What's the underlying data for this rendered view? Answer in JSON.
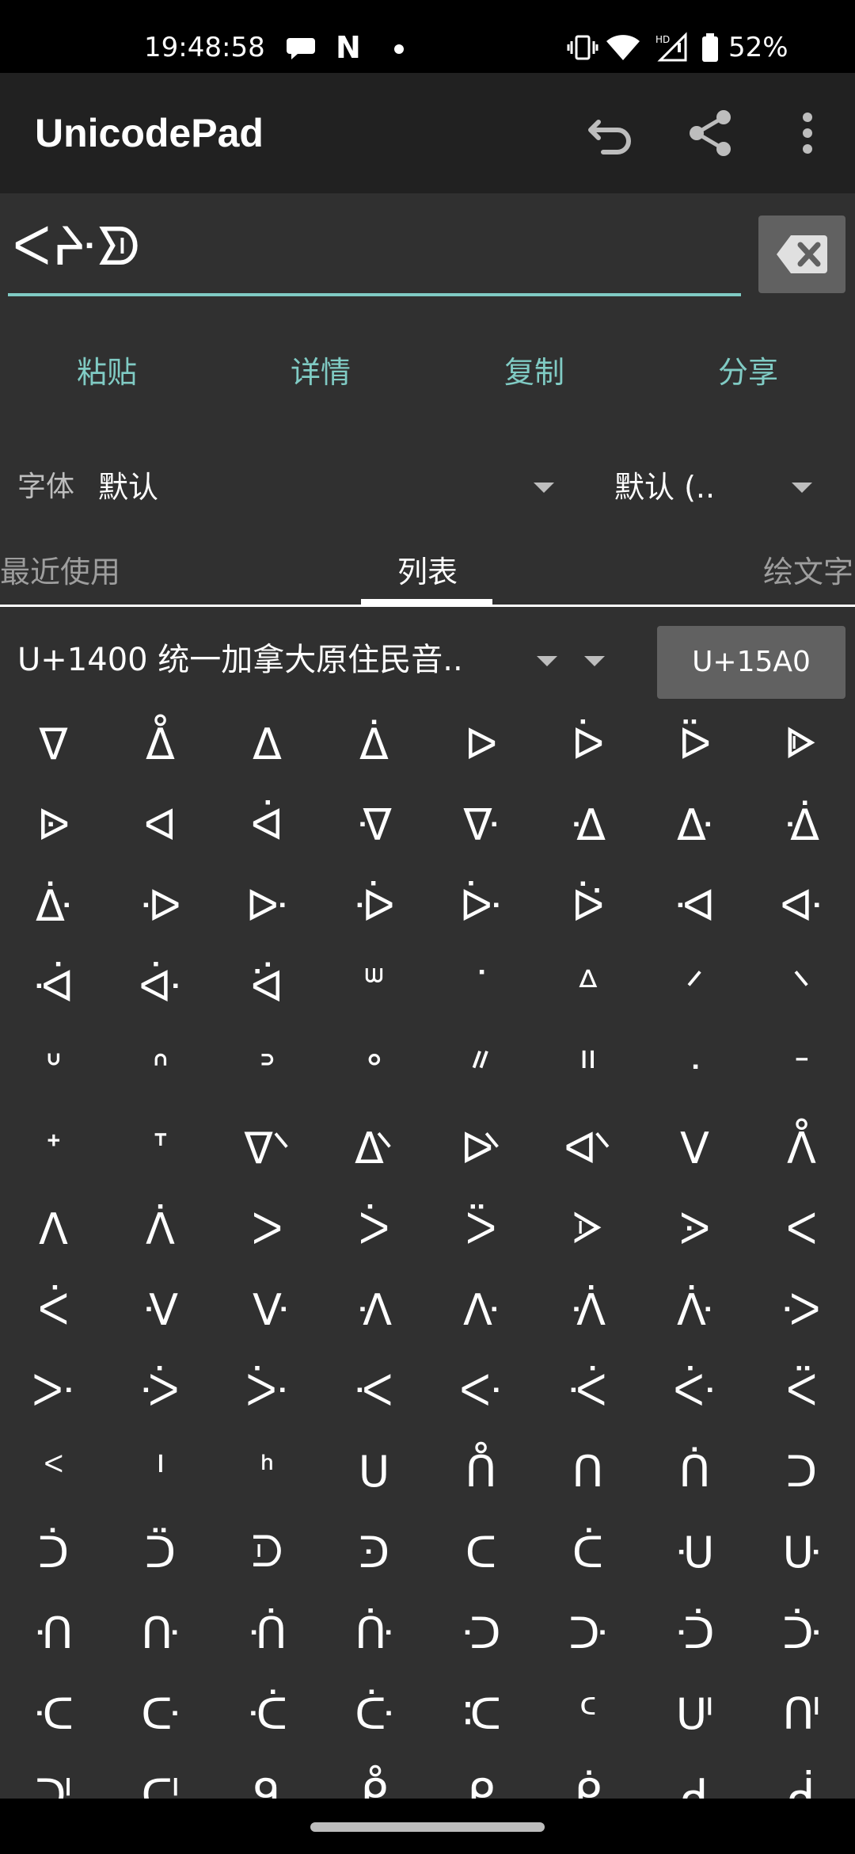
{
  "status_bar": {
    "time": "19:48:58",
    "battery_percent": "52%",
    "icons": [
      "chat-bubble-icon",
      "n-icon",
      "dot-icon",
      "vibrate-icon",
      "wifi-icon",
      "hd-signal-icon",
      "battery-icon"
    ]
  },
  "app_bar": {
    "title": "UnicodePad",
    "actions": [
      "undo-icon",
      "share-icon",
      "more-vert-icon"
    ]
  },
  "editor": {
    "text": "ᐸᔲᗥ",
    "accent_color": "#80cbc4"
  },
  "buttons": [
    "粘贴",
    "详情",
    "复制",
    "分享"
  ],
  "font_row": {
    "label": "字体",
    "font_value": "默认",
    "locale_value": "默认 (.."
  },
  "tabs": {
    "items": [
      "最近使用",
      "列表",
      "绘文字"
    ],
    "active": "列表"
  },
  "block": {
    "name": "U+1400 统一加拿大原住民音..",
    "jump_label": "U+15A0"
  },
  "grid": {
    "chars": [
      "ᐁ",
      "ᐂ",
      "ᐃ",
      "ᐄ",
      "ᐅ",
      "ᐆ",
      "ᐇ",
      "ᐈ",
      "ᐉ",
      "ᐊ",
      "ᐋ",
      "ᐌ",
      "ᐍ",
      "ᐎ",
      "ᐏ",
      "ᐐ",
      "ᐑ",
      "ᐒ",
      "ᐓ",
      "ᐔ",
      "ᐕ",
      "ᐖ",
      "ᐗ",
      "ᐘ",
      "ᐙ",
      "ᐚ",
      "ᐛ",
      "ᐜ",
      "ᐝ",
      "ᐞ",
      "ᐟ",
      "ᐠ",
      "ᐡ",
      "ᐢ",
      "ᐣ",
      "ᐤ",
      "ᐥ",
      "ᐦ",
      "ᐧ",
      "ᐨ",
      "ᐩ",
      "ᐪ",
      "ᐫ",
      "ᐬ",
      "ᐭ",
      "ᐮ",
      "ᐯ",
      "ᐰ",
      "ᐱ",
      "ᐲ",
      "ᐳ",
      "ᐴ",
      "ᐵ",
      "ᐶ",
      "ᐷ",
      "ᐸ",
      "ᐹ",
      "ᐺ",
      "ᐻ",
      "ᐼ",
      "ᐽ",
      "ᐾ",
      "ᐿ",
      "ᑀ",
      "ᑁ",
      "ᑂ",
      "ᑃ",
      "ᑄ",
      "ᑅ",
      "ᑆ",
      "ᑇ",
      "ᑈ",
      "ᑉ",
      "ᑊ",
      "ᑋ",
      "ᑌ",
      "ᑍ",
      "ᑎ",
      "ᑏ",
      "ᑐ",
      "ᑑ",
      "ᑒ",
      "ᑓ",
      "ᑔ",
      "ᑕ",
      "ᑖ",
      "ᑗ",
      "ᑘ",
      "ᑙ",
      "ᑚ",
      "ᑛ",
      "ᑜ",
      "ᑝ",
      "ᑞ",
      "ᑟ",
      "ᑠ",
      "ᑡ",
      "ᑢ",
      "ᑣ",
      "ᑤ",
      "ᑥ",
      "ᑦ",
      "ᑧ",
      "ᑨ",
      "ᑩ",
      "ᑪ",
      "ᑫ",
      "ᑬ",
      "ᑭ",
      "ᑮ",
      "ᑯ",
      "ᑰ"
    ]
  }
}
